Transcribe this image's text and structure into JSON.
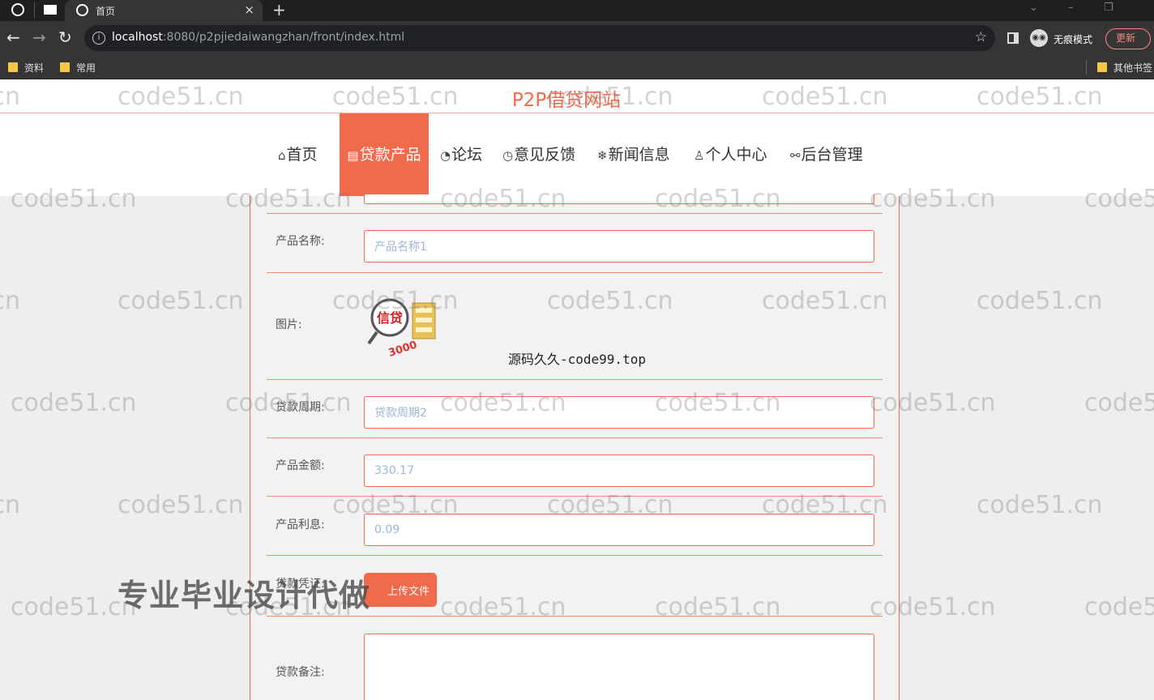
{
  "browser": {
    "tab_title": "首页",
    "tab_close": "×",
    "new_tab": "+",
    "url_host": "localhost",
    "url_rest": ":8080/p2pjiedaiwangzhan/front/index.html",
    "incognito_label": "无痕模式",
    "update_label": "更新",
    "bookmarks": [
      "资料",
      "常用"
    ],
    "other_bookmarks": "其他书签"
  },
  "site": {
    "title": "P2P借贷网站",
    "nav": [
      {
        "icon": "⌂",
        "label": "首页"
      },
      {
        "icon": "▤",
        "label": "贷款产品"
      },
      {
        "icon": "◔",
        "label": "论坛"
      },
      {
        "icon": "◷",
        "label": "意见反馈"
      },
      {
        "icon": "❄",
        "label": "新闻信息"
      },
      {
        "icon": "♙",
        "label": "个人中心"
      },
      {
        "icon": "⚯",
        "label": "后台管理"
      }
    ]
  },
  "form": {
    "name_label": "产品名称:",
    "name_value": "产品名称1",
    "image_label": "图片:",
    "image_text": "信贷",
    "period_label": "贷款周期:",
    "period_value": "贷款周期2",
    "amount_label": "产品金额:",
    "amount_value": "330.17",
    "interest_label": "产品利息:",
    "interest_value": "0.09",
    "proof_label": "贷款凭证:",
    "upload_label": "上传文件",
    "remark_label": "贷款备注:"
  },
  "overlays": {
    "credit": "源码久久-code99.top",
    "banner": "专业毕业设计代做",
    "watermark": "code51.cn"
  }
}
